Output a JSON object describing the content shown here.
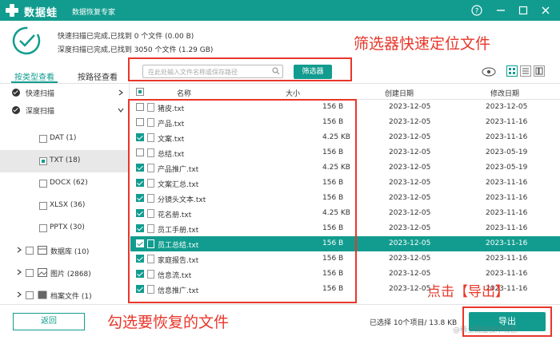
{
  "app": {
    "name": "数据蛙",
    "slogan": "数据恢复专家",
    "accent": "#129c8f",
    "annotation_color": "#e8362a"
  },
  "scan": {
    "quick": "快速扫描已完成,已找到 0 个文件 (0.00  B)",
    "deep": "深度扫描已完成,已找到 3050 个文件 (1.29 GB)"
  },
  "annotations": {
    "filter": "筛选器快速定位文件",
    "select": "勾选要恢复的文件",
    "export": "点击【导出】"
  },
  "tabs": [
    "按类型查看",
    "按路径查看"
  ],
  "search": {
    "placeholder": "在此处输入文件名称或保存路径",
    "filter_label": "筛选器"
  },
  "tree": {
    "quick_scan": "快速扫描",
    "deep_scan": "深度扫描",
    "items": [
      {
        "label": "DAT (1)"
      },
      {
        "label": "TXT (18)"
      },
      {
        "label": "DOCX (62)"
      },
      {
        "label": "XLSX (36)"
      },
      {
        "label": "PPTX (30)"
      },
      {
        "label": "数据库 (10)"
      },
      {
        "label": "图片 (2868)"
      },
      {
        "label": "档案文件 (1)"
      }
    ]
  },
  "table": {
    "headers": [
      "名称",
      "大小",
      "创建日期",
      "修改日期"
    ],
    "rows": [
      {
        "name": "猪皮.txt",
        "size": "156  B",
        "created": "2023-12-05",
        "modified": "2023-12-05",
        "checked": false
      },
      {
        "name": "产品.txt",
        "size": "156  B",
        "created": "2023-12-05",
        "modified": "2023-11-16",
        "checked": false
      },
      {
        "name": "文案.txt",
        "size": "4.25 KB",
        "created": "2023-12-05",
        "modified": "2023-11-16",
        "checked": true
      },
      {
        "name": "总结.txt",
        "size": "156  B",
        "created": "2023-12-05",
        "modified": "2023-05-19",
        "checked": false
      },
      {
        "name": "产品推广.txt",
        "size": "4.25 KB",
        "created": "2023-12-05",
        "modified": "2023-05-19",
        "checked": true
      },
      {
        "name": "文案汇总.txt",
        "size": "156  B",
        "created": "2023-12-05",
        "modified": "2023-11-16",
        "checked": true
      },
      {
        "name": "分镜头文本.txt",
        "size": "156  B",
        "created": "2023-12-05",
        "modified": "2023-11-16",
        "checked": true
      },
      {
        "name": "花名册.txt",
        "size": "4.25 KB",
        "created": "2023-12-05",
        "modified": "2023-11-16",
        "checked": true
      },
      {
        "name": "员工手册.txt",
        "size": "156  B",
        "created": "2023-12-05",
        "modified": "2023-11-16",
        "checked": true
      },
      {
        "name": "员工总结.txt",
        "size": "156  B",
        "created": "2023-12-05",
        "modified": "2023-11-16",
        "checked": true
      },
      {
        "name": "家庭报告.txt",
        "size": "156  B",
        "created": "2023-12-05",
        "modified": "2023-11-16",
        "checked": true
      },
      {
        "name": "信息流.txt",
        "size": "156  B",
        "created": "2023-12-05",
        "modified": "2023-11-16",
        "checked": true
      },
      {
        "name": "信息推广.txt",
        "size": "156  B",
        "created": "2023-12-05",
        "modified": "2023-11-16",
        "checked": true
      }
    ]
  },
  "footer": {
    "back": "返回",
    "status": "已选择 10个项目/ 13.8 KB",
    "export": "导出",
    "watermark": "@稀土掘金技术社区"
  }
}
